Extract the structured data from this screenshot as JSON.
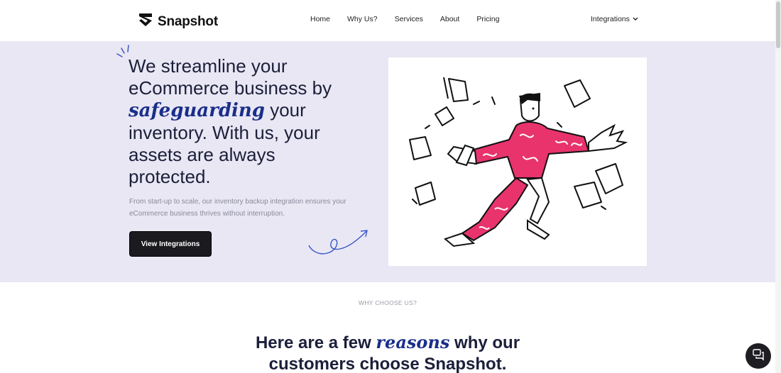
{
  "header": {
    "brand": "Snapshot",
    "nav": [
      "Home",
      "Why Us?",
      "Services",
      "About",
      "Pricing"
    ],
    "integrations": "Integrations"
  },
  "hero": {
    "line1": "We streamline your",
    "line2": "eCommerce business by",
    "accent": "safeguarding",
    "line3_rest": " your",
    "line4": "inventory. With us, your",
    "line5": "assets are always",
    "line6": "protected.",
    "subtitle": "From start-up to scale, our inventory backup integration ensures your eCommerce business thrives without interruption.",
    "cta": "View Integrations"
  },
  "why": {
    "label": "WHY CHOOSE US?",
    "title_pre": "Here are a few ",
    "title_accent": "reasons",
    "title_post": " why our",
    "title_line2": "customers choose Snapshot."
  },
  "colors": {
    "hero_bg": "#e9e7f4",
    "accent_blue": "#1a2f8a",
    "illustration_pink": "#e8336d",
    "cta_bg": "#1b1b1f"
  },
  "icons": {
    "logo": "snapshot-shield-logo-icon",
    "chevron": "chevron-down-icon",
    "chat": "chat-bubbles-icon"
  }
}
